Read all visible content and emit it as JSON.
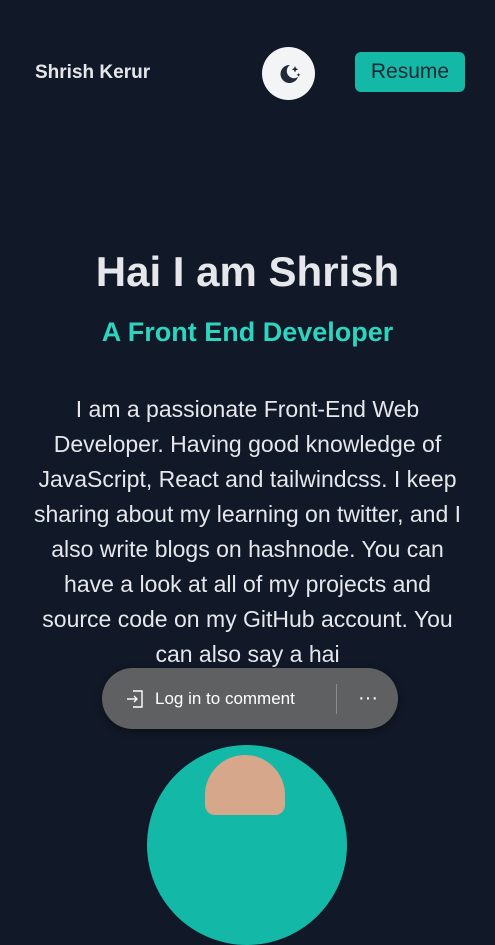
{
  "header": {
    "brand": "Shrish Kerur",
    "theme_toggle_icon": "moon-stars-icon",
    "resume_label": "Resume"
  },
  "hero": {
    "title": "Hai I am Shrish",
    "subtitle": "A Front End Developer",
    "bio": "I am a passionate Front-End Web Developer. Having good knowledge of JavaScript, React and tailwindcss. I keep sharing about my learning on twitter, and I also write blogs on hashnode. You can have a look at all of my projects and source code on my GitHub account. You can also say a hai"
  },
  "comment_bar": {
    "login_label": "Log in to comment",
    "login_icon": "sign-in-icon",
    "more_icon": "more-options-icon",
    "more_label": "···"
  },
  "colors": {
    "background": "#111827",
    "accent": "#14b8a6",
    "accent_text": "#2dd4bf"
  }
}
